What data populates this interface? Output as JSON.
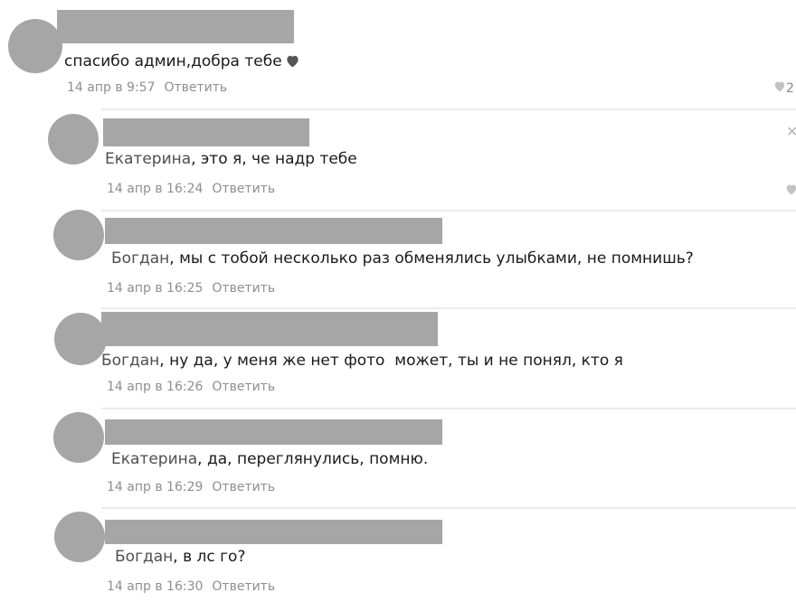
{
  "comments": [
    {
      "author": "",
      "text": "спасибо админ,добра тебе",
      "time": "14 апр в 9:57",
      "reply_label": "Ответить",
      "likes": "2"
    },
    {
      "author": "Екатерина",
      "text": ", это я, че надр тебе",
      "time": "14 апр в 16:24",
      "reply_label": "Ответить"
    },
    {
      "author": "Богдан",
      "text": ", мы с тобой несколько раз обменялись улыбками, не помнишь?",
      "time": "14 апр в 16:25",
      "reply_label": "Ответить"
    },
    {
      "author": "Богдан",
      "text": ", ну да, у меня же нет фото  может, ты и не понял, кто я",
      "time": "14 апр в 16:26",
      "reply_label": "Ответить"
    },
    {
      "author": "Екатерина",
      "text": ", да, переглянулись, помню.",
      "time": "14 апр в 16:29",
      "reply_label": "Ответить"
    },
    {
      "author": "Богдан",
      "text": ", в лс го?",
      "time": "14 апр в 16:30",
      "reply_label": "Ответить"
    }
  ],
  "icons": {
    "heart": "heart-icon",
    "like": "like-heart-icon",
    "close": "close-icon"
  },
  "colors": {
    "redaction": "#a6a6a6",
    "meta": "#8e8e8e",
    "author": "#4e4e4e"
  }
}
